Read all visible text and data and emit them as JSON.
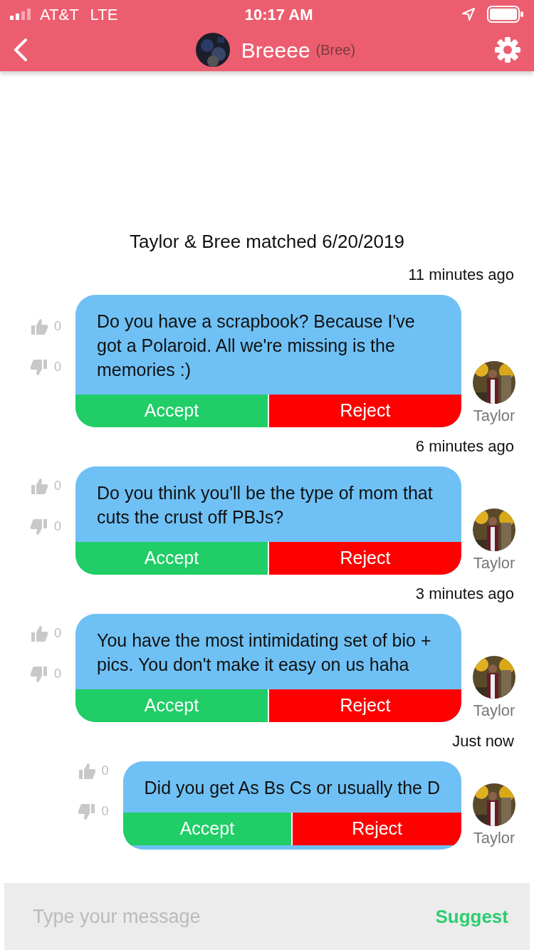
{
  "status_bar": {
    "carrier": "AT&T",
    "network": "LTE",
    "time": "10:17 AM"
  },
  "header": {
    "name": "Breeee",
    "alias": "(Bree)"
  },
  "match_note": "Taylor & Bree matched 6/20/2019",
  "messages": [
    {
      "time": "11 minutes ago",
      "text": "Do you have a scrapbook? Because I've got a Polaroid. All we're missing is the memories :)",
      "likes": "0",
      "dislikes": "0",
      "accept": "Accept",
      "reject": "Reject",
      "sender": "Taylor"
    },
    {
      "time": "6 minutes ago",
      "text": "Do you think you'll be the type of mom that cuts the crust off PBJs?",
      "likes": "0",
      "dislikes": "0",
      "accept": "Accept",
      "reject": "Reject",
      "sender": "Taylor"
    },
    {
      "time": "3 minutes ago",
      "text": "You have the most intimidating set of bio + pics. You don't make it easy on us haha",
      "likes": "0",
      "dislikes": "0",
      "accept": "Accept",
      "reject": "Reject",
      "sender": "Taylor"
    },
    {
      "time": "Just now",
      "text": "Did you get As Bs Cs or usually the D",
      "likes": "0",
      "dislikes": "0",
      "accept": "Accept",
      "reject": "Reject",
      "sender": "Taylor"
    }
  ],
  "composer": {
    "placeholder": "Type your message",
    "action": "Suggest"
  }
}
